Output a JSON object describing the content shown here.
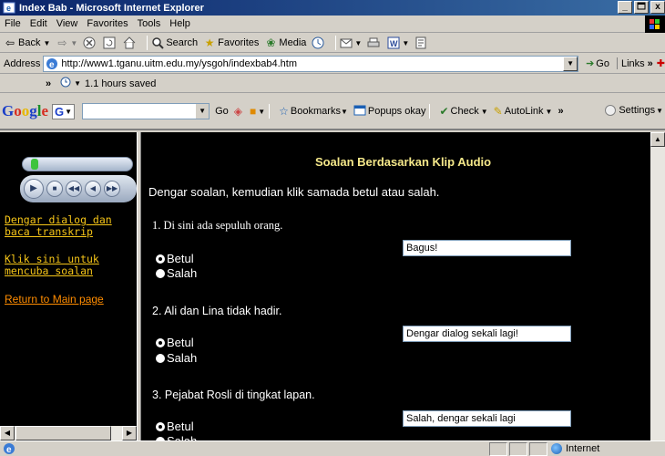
{
  "window": {
    "title": "Index Bab - Microsoft Internet Explorer",
    "controls": [
      "_",
      " ",
      "x"
    ]
  },
  "menu": [
    "File",
    "Edit",
    "View",
    "Favorites",
    "Tools",
    "Help"
  ],
  "toolbar": {
    "back": "Back",
    "search": "Search",
    "favorites": "Favorites",
    "media": "Media"
  },
  "address": {
    "label": "Address",
    "url": "http://www1.tganu.uitm.edu.my/ysgoh/indexbab4.htm",
    "go": "Go",
    "links": "Links"
  },
  "history": {
    "chevron": "»",
    "text": "1.1 hours saved"
  },
  "google": {
    "logo": [
      "G",
      "o",
      "o",
      "g",
      "l",
      "e"
    ],
    "g_button": "G",
    "go": "Go",
    "bookmarks": "Bookmarks",
    "popups": "Popups okay",
    "check": "Check",
    "autolink": "AutoLink",
    "more": "»",
    "settings": "Settings"
  },
  "left_frame": {
    "links": [
      "Dengar dialog dan baca transkrip",
      "Klik sini untuk mencuba soalan"
    ],
    "return_link": "Return to Main page"
  },
  "quiz": {
    "title": "Soalan Berdasarkan Klip Audio",
    "instruction": "Dengar soalan, kemudian klik samada betul atau salah.",
    "option_true": "Betul",
    "option_false": "Salah",
    "questions": [
      {
        "text": "1. Di sini ada sepuluh orang.",
        "feedback": "Bagus!",
        "selected": "Betul"
      },
      {
        "text": "2. Ali dan Lina tidak hadir.",
        "feedback": "Dengar dialog sekali lagi!",
        "selected": "Betul"
      },
      {
        "text": "3. Pejabat Rosli di tingkat lapan.",
        "feedback": "Salah, dengar sekali lagi",
        "selected": "Betul"
      }
    ]
  },
  "status": {
    "zone": "Internet"
  },
  "colors": {
    "title_gradient_start": "#0a246a",
    "quiz_title": "#f5e88a",
    "left_link": "#f5c518",
    "return_link": "#ff8c00",
    "page_background": "#000000"
  }
}
